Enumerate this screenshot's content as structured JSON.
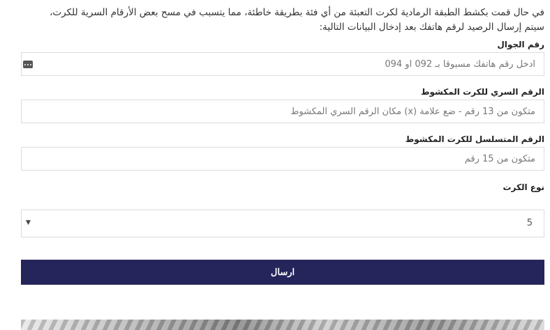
{
  "intro": {
    "line1": "في حال قمت بكشط الطبقة الرمادية لكرت التعبئة من أي فئة بطريقة خاطئة، مما يتسبب في مسح بعض الأرقام السرية للكرت،",
    "line2": "سيتم إرسال الرصيد لرقم هاتفك بعد إدخال البيانات التالية:"
  },
  "form": {
    "phone": {
      "label": "رقم الجوال",
      "placeholder": "ادخل رقم هاتفك مسبوقا بـ 092 او 094",
      "value": ""
    },
    "pin": {
      "label": "الرقم السري للكرت المكشوط",
      "placeholder": "متكون من 13 رقم - ضع علامة (x) مكان الرقم السري المكشوط",
      "value": ""
    },
    "serial": {
      "label": "الرقم المتسلسل للكرت المكشوط",
      "placeholder": "متكون من 15 رقم",
      "value": ""
    },
    "card_type": {
      "label": "نوع الكرت",
      "selected": "5"
    },
    "submit_label": "ارسال"
  },
  "icons": {
    "password_manager": "password-manager-icon",
    "dropdown": "caret-down-icon"
  },
  "colors": {
    "submit_bg": "#25255c",
    "border": "#dcdcdc"
  }
}
